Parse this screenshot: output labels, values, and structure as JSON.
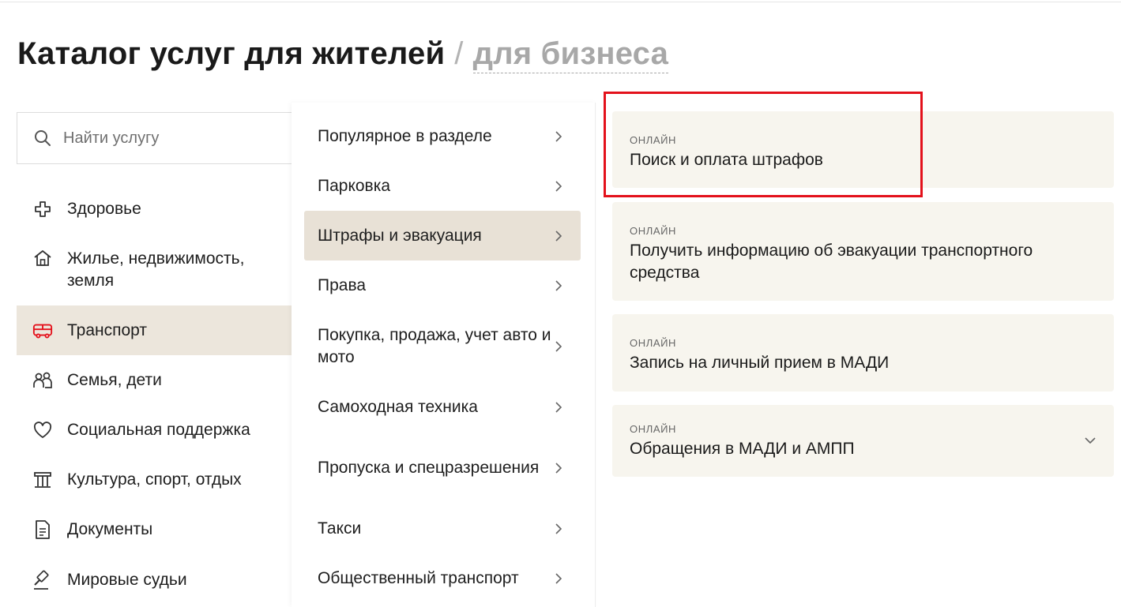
{
  "header": {
    "title_primary": "Каталог услуг для жителей",
    "separator": "/",
    "title_secondary": "для бизнеса"
  },
  "search": {
    "placeholder": "Найти услугу",
    "icon": "search-icon"
  },
  "categories": [
    {
      "label": "Здоровье",
      "icon": "health-cross-icon"
    },
    {
      "label": "Жилье, недвижимость, земля",
      "icon": "house-icon"
    },
    {
      "label": "Транспорт",
      "icon": "bus-icon",
      "active": true
    },
    {
      "label": "Семья, дети",
      "icon": "family-icon"
    },
    {
      "label": "Социальная поддержка",
      "icon": "heart-icon"
    },
    {
      "label": "Культура, спорт, отдых",
      "icon": "museum-icon"
    },
    {
      "label": "Документы",
      "icon": "document-icon"
    },
    {
      "label": "Мировые судьи",
      "icon": "gavel-icon"
    }
  ],
  "subcategories": [
    {
      "label": "Популярное в разделе"
    },
    {
      "label": "Парковка"
    },
    {
      "label": "Штрафы и эвакуация",
      "active": true
    },
    {
      "label": "Права"
    },
    {
      "label": "Покупка, продажа, учет авто и мото"
    },
    {
      "label": "Самоходная техника"
    },
    {
      "label": "Пропуска и спецразрешения"
    },
    {
      "label": "Такси"
    },
    {
      "label": "Общественный транспорт"
    }
  ],
  "services": [
    {
      "badge": "ОНЛАЙН",
      "title": "Поиск и оплата штрафов",
      "highlighted": true
    },
    {
      "badge": "ОНЛАЙН",
      "title": "Получить информацию об эвакуации транспортного средства"
    },
    {
      "badge": "ОНЛАЙН",
      "title": "Запись на личный прием в МАДИ"
    },
    {
      "badge": "ОНЛАЙН",
      "title": "Обращения в МАДИ и АМПП",
      "expandable": true
    }
  ],
  "colors": {
    "accent_red": "#e3111b",
    "active_bg": "#ece6dc",
    "card_bg": "#f7f5ee",
    "muted_text": "#a8a8a8"
  }
}
